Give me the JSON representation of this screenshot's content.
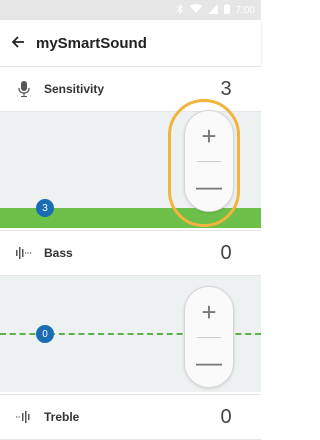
{
  "status_bar": {
    "time": "7:00",
    "icons": [
      "bluetooth-icon",
      "wifi-icon",
      "signal-icon",
      "battery-icon"
    ]
  },
  "app_bar": {
    "title": "mySmartSound",
    "back_icon": "arrow-left-icon"
  },
  "settings": [
    {
      "label": "Sensitivity",
      "value": "3",
      "icon": "microphone-icon",
      "knob_label": "3",
      "slider_fill": "level",
      "increase_label": "+",
      "decrease_label": "—"
    },
    {
      "label": "Bass",
      "value": "0",
      "icon": "bass-equalizer-icon",
      "knob_label": "0",
      "slider_fill": "line",
      "increase_label": "+",
      "decrease_label": "—"
    },
    {
      "label": "Treble",
      "value": "0",
      "icon": "treble-equalizer-icon"
    }
  ],
  "colors": {
    "accent_blue": "#1a6db5",
    "level_green": "#6cc04a",
    "highlight_orange": "#f3b33d",
    "panel_bg": "#eef1f1"
  }
}
